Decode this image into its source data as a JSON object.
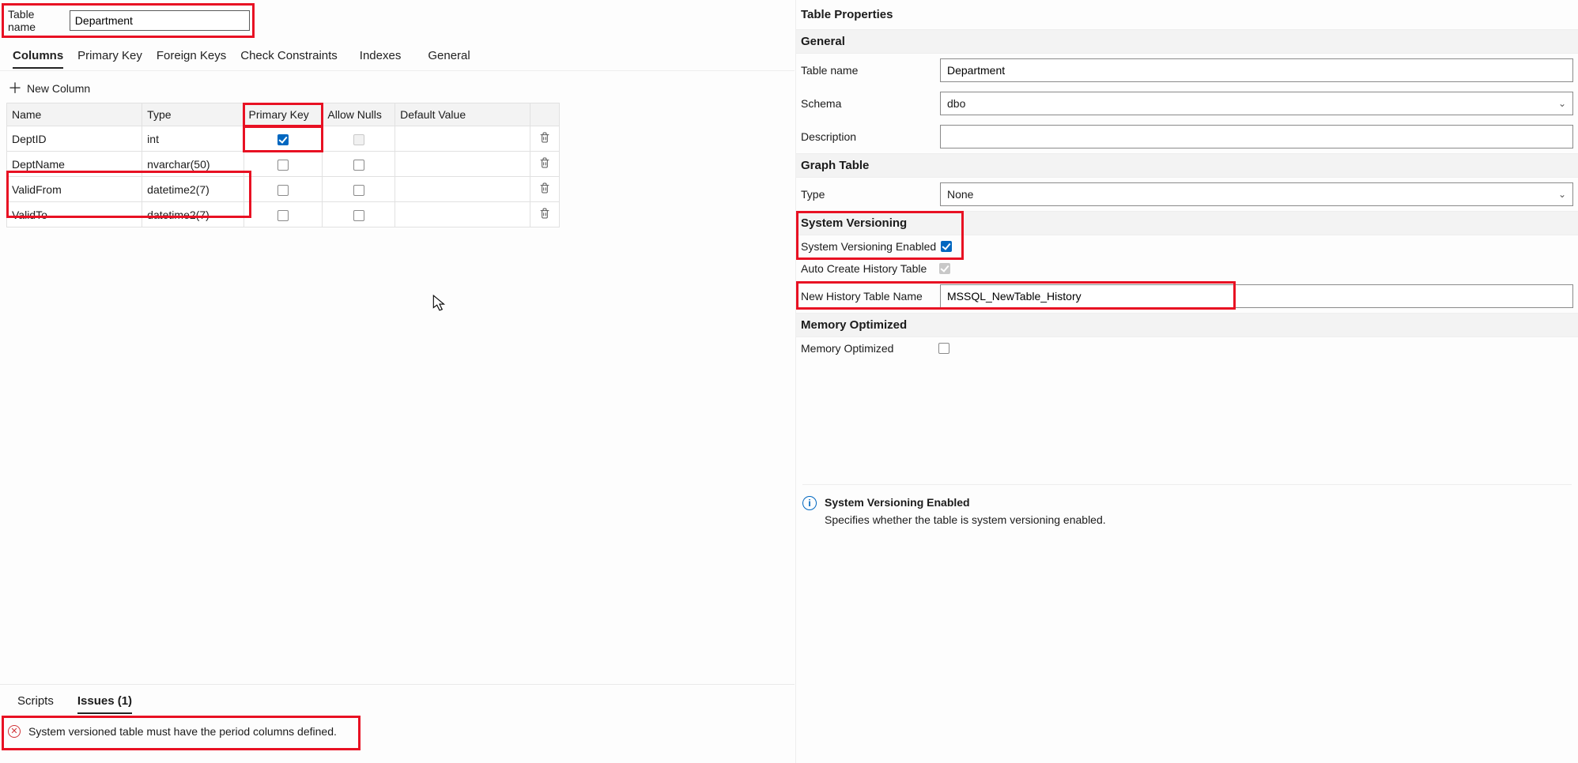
{
  "top": {
    "table_name_label": "Table name",
    "table_name_value": "Department"
  },
  "tabs": [
    {
      "label": "Columns",
      "active": true
    },
    {
      "label": "Primary Key",
      "active": false
    },
    {
      "label": "Foreign Keys",
      "active": false
    },
    {
      "label": "Check Constraints",
      "active": false
    },
    {
      "label": "Indexes",
      "active": false
    },
    {
      "label": "General",
      "active": false
    }
  ],
  "new_column_label": "New Column",
  "columns_table": {
    "headers": {
      "name": "Name",
      "type": "Type",
      "pk": "Primary Key",
      "nulls": "Allow Nulls",
      "default": "Default Value"
    },
    "rows": [
      {
        "name": "DeptID",
        "type": "int",
        "pk": true,
        "pk_disabled": false,
        "nulls": false,
        "nulls_disabled": true,
        "default": ""
      },
      {
        "name": "DeptName",
        "type": "nvarchar(50)",
        "pk": false,
        "pk_disabled": false,
        "nulls": false,
        "nulls_disabled": false,
        "default": ""
      },
      {
        "name": "ValidFrom",
        "type": "datetime2(7)",
        "pk": false,
        "pk_disabled": false,
        "nulls": false,
        "nulls_disabled": false,
        "default": ""
      },
      {
        "name": "ValidTo",
        "type": "datetime2(7)",
        "pk": false,
        "pk_disabled": false,
        "nulls": false,
        "nulls_disabled": false,
        "default": ""
      }
    ]
  },
  "properties": {
    "title": "Table Properties",
    "general": {
      "heading": "General",
      "table_name_label": "Table name",
      "table_name_value": "Department",
      "schema_label": "Schema",
      "schema_value": "dbo",
      "description_label": "Description",
      "description_value": ""
    },
    "graph": {
      "heading": "Graph Table",
      "type_label": "Type",
      "type_value": "None"
    },
    "versioning": {
      "heading": "System Versioning",
      "enabled_label": "System Versioning Enabled",
      "enabled": true,
      "auto_label": "Auto Create History Table",
      "auto_checked": true,
      "auto_disabled": true,
      "history_name_label": "New History Table Name",
      "history_name_value": "MSSQL_NewTable_History"
    },
    "memory": {
      "heading": "Memory Optimized",
      "label": "Memory Optimized",
      "checked": false
    },
    "info": {
      "title": "System Versioning Enabled",
      "desc": "Specifies whether the table is system versioning enabled."
    }
  },
  "bottom": {
    "tabs": [
      {
        "label": "Scripts",
        "active": false
      },
      {
        "label": "Issues (1)",
        "active": true
      }
    ],
    "issue_text": "System versioned table must have the period columns defined."
  }
}
